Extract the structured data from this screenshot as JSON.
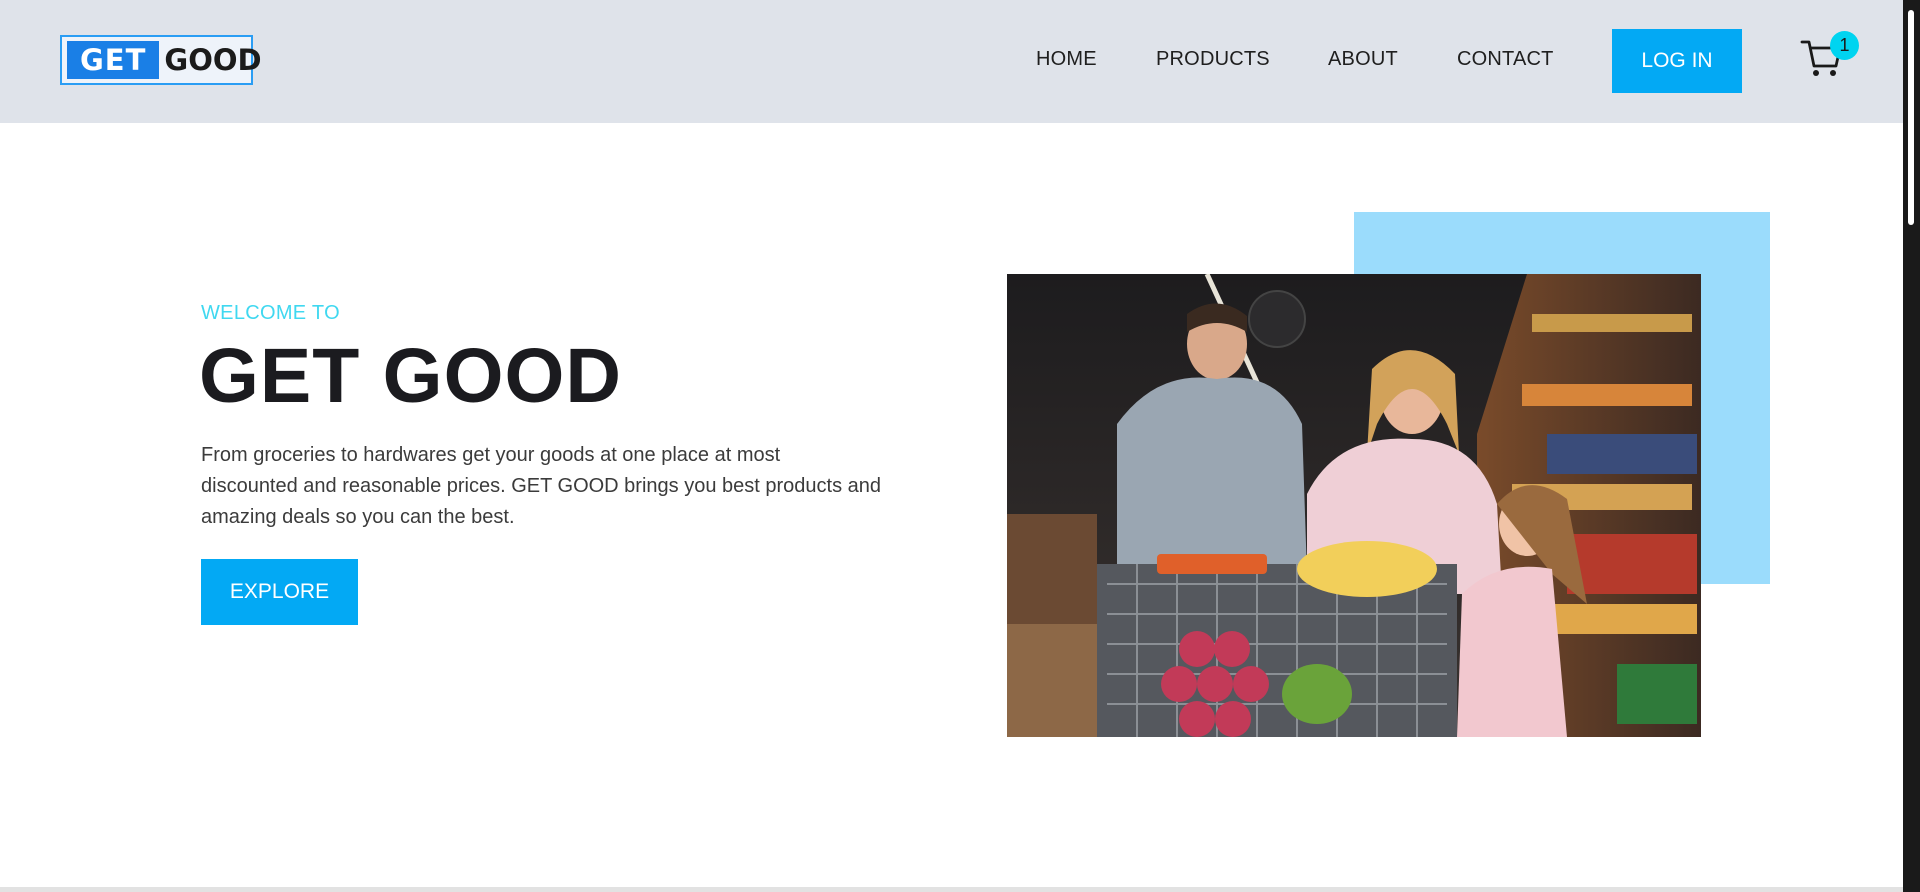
{
  "logo": {
    "part1": "GET",
    "part2": "GOOD"
  },
  "nav": {
    "home": "HOME",
    "products": "PRODUCTS",
    "about": "ABOUT",
    "contact": "CONTACT",
    "login": "LOG IN",
    "cart_icon": "cart-icon",
    "cart_count": "1"
  },
  "hero": {
    "welcome": "WELCOME TO",
    "title": "GET GOOD",
    "description": "From groceries to hardwares get your goods at one place at most discounted and reasonable prices. GET GOOD brings you best products and amazing deals so you can the best.",
    "explore": "EXPLORE",
    "image": "family-shopping-photo"
  },
  "colors": {
    "accent": "#03a9f4",
    "welcome": "#40d8f0",
    "badge": "#00d4f0",
    "navbar_bg": "#dfe3ea",
    "accent_box": "#9bdcfc"
  }
}
